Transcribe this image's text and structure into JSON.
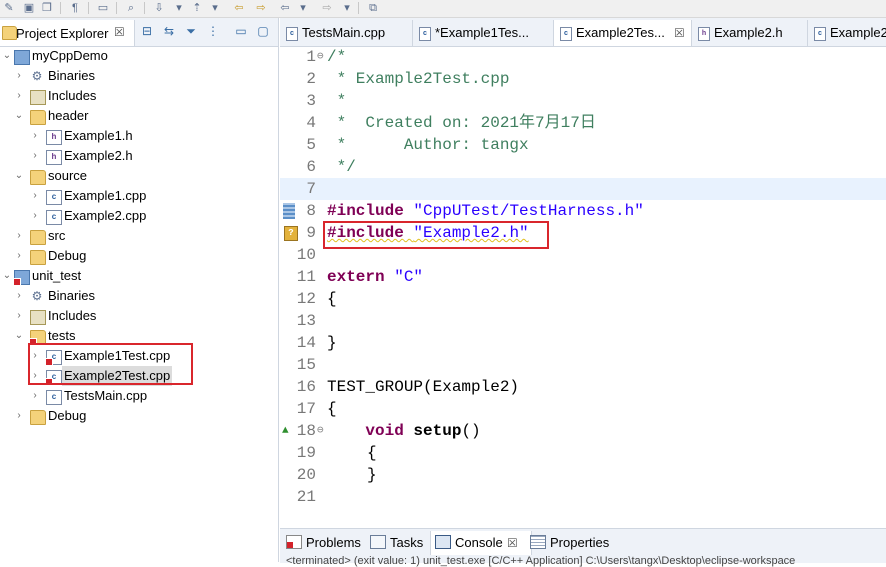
{
  "toolbar": {
    "icons": [
      "new-icon",
      "save-icon",
      "save-all-icon",
      "pilcrow-icon",
      "monitor-icon",
      "search-icon",
      "run-icon",
      "link-icon",
      "back-icon",
      "forward-icon",
      "nav-back-icon",
      "nav-forward-icon",
      "open-perspective-icon"
    ]
  },
  "project_explorer": {
    "title": "Project Explorer",
    "close": "☒",
    "tree": [
      {
        "label": "myCppDemo",
        "level": 0,
        "icon": "project",
        "expanded": true
      },
      {
        "label": "Binaries",
        "level": 1,
        "icon": "binaries",
        "expanded": false
      },
      {
        "label": "Includes",
        "level": 1,
        "icon": "includes",
        "expanded": false
      },
      {
        "label": "header",
        "level": 1,
        "icon": "folder",
        "expanded": true
      },
      {
        "label": "Example1.h",
        "level": 2,
        "icon": "h",
        "expanded": false
      },
      {
        "label": "Example2.h",
        "level": 2,
        "icon": "h",
        "expanded": false
      },
      {
        "label": "source",
        "level": 1,
        "icon": "folder",
        "expanded": true
      },
      {
        "label": "Example1.cpp",
        "level": 2,
        "icon": "c",
        "expanded": false
      },
      {
        "label": "Example2.cpp",
        "level": 2,
        "icon": "c",
        "expanded": false
      },
      {
        "label": "src",
        "level": 1,
        "icon": "folder",
        "expanded": false
      },
      {
        "label": "Debug",
        "level": 1,
        "icon": "folder",
        "expanded": false
      },
      {
        "label": "unit_test",
        "level": 0,
        "icon": "project",
        "expanded": true
      },
      {
        "label": "Binaries",
        "level": 1,
        "icon": "binaries",
        "expanded": false
      },
      {
        "label": "Includes",
        "level": 1,
        "icon": "includes",
        "expanded": false
      },
      {
        "label": "tests",
        "level": 1,
        "icon": "folder",
        "expanded": true
      },
      {
        "label": "Example1Test.cpp",
        "level": 2,
        "icon": "c",
        "expanded": false
      },
      {
        "label": "Example2Test.cpp",
        "level": 2,
        "icon": "c",
        "expanded": false
      },
      {
        "label": "TestsMain.cpp",
        "level": 2,
        "icon": "c",
        "expanded": false
      },
      {
        "label": "Debug",
        "level": 1,
        "icon": "folder",
        "expanded": false
      }
    ]
  },
  "editor": {
    "tabs": [
      {
        "label": "TestsMain.cpp",
        "icon": "c"
      },
      {
        "label": "*Example1Tes...",
        "icon": "c"
      },
      {
        "label": "Example2Tes...",
        "icon": "c",
        "active": true,
        "close": "☒"
      },
      {
        "label": "Example2.h",
        "icon": "h"
      },
      {
        "label": "Example2",
        "icon": "c"
      }
    ],
    "lines": [
      {
        "n": "1",
        "text": "/*"
      },
      {
        "n": "2",
        "text": " * Example2Test.cpp"
      },
      {
        "n": "3",
        "text": " *"
      },
      {
        "n": "4",
        "text": " *  Created on: 2021年7月17日"
      },
      {
        "n": "5",
        "text": " *      Author: tangx"
      },
      {
        "n": "6",
        "text": " */"
      },
      {
        "n": "7",
        "text": ""
      },
      {
        "n": "8",
        "text_pp": "#include",
        "text_str": "\"CppUTest/TestHarness.h\""
      },
      {
        "n": "9",
        "text_pp": "#include",
        "text_str": "\"Example2.h\""
      },
      {
        "n": "10",
        "text": ""
      },
      {
        "n": "11",
        "text_kw": "extern",
        "text_str": "\"C\""
      },
      {
        "n": "12",
        "text": "{"
      },
      {
        "n": "13",
        "text": ""
      },
      {
        "n": "14",
        "text": "}"
      },
      {
        "n": "15",
        "text": ""
      },
      {
        "n": "16",
        "text": "TEST_GROUP(Example2)"
      },
      {
        "n": "17",
        "text": "{"
      },
      {
        "n": "18",
        "text_kw": "void",
        "text_fn": "setup",
        "text_rest": "()"
      },
      {
        "n": "19",
        "text": "{"
      },
      {
        "n": "20",
        "text": "}"
      },
      {
        "n": "21",
        "text": ""
      }
    ]
  },
  "bottom": {
    "tabs": [
      "Problems",
      "Tasks",
      "Console",
      "Properties"
    ],
    "active": "Console",
    "console_close": "☒",
    "console_text": "<terminated> (exit value: 1) unit_test.exe [C/C++ Application] C:\\Users\\tangx\\Desktop\\eclipse-workspace"
  }
}
